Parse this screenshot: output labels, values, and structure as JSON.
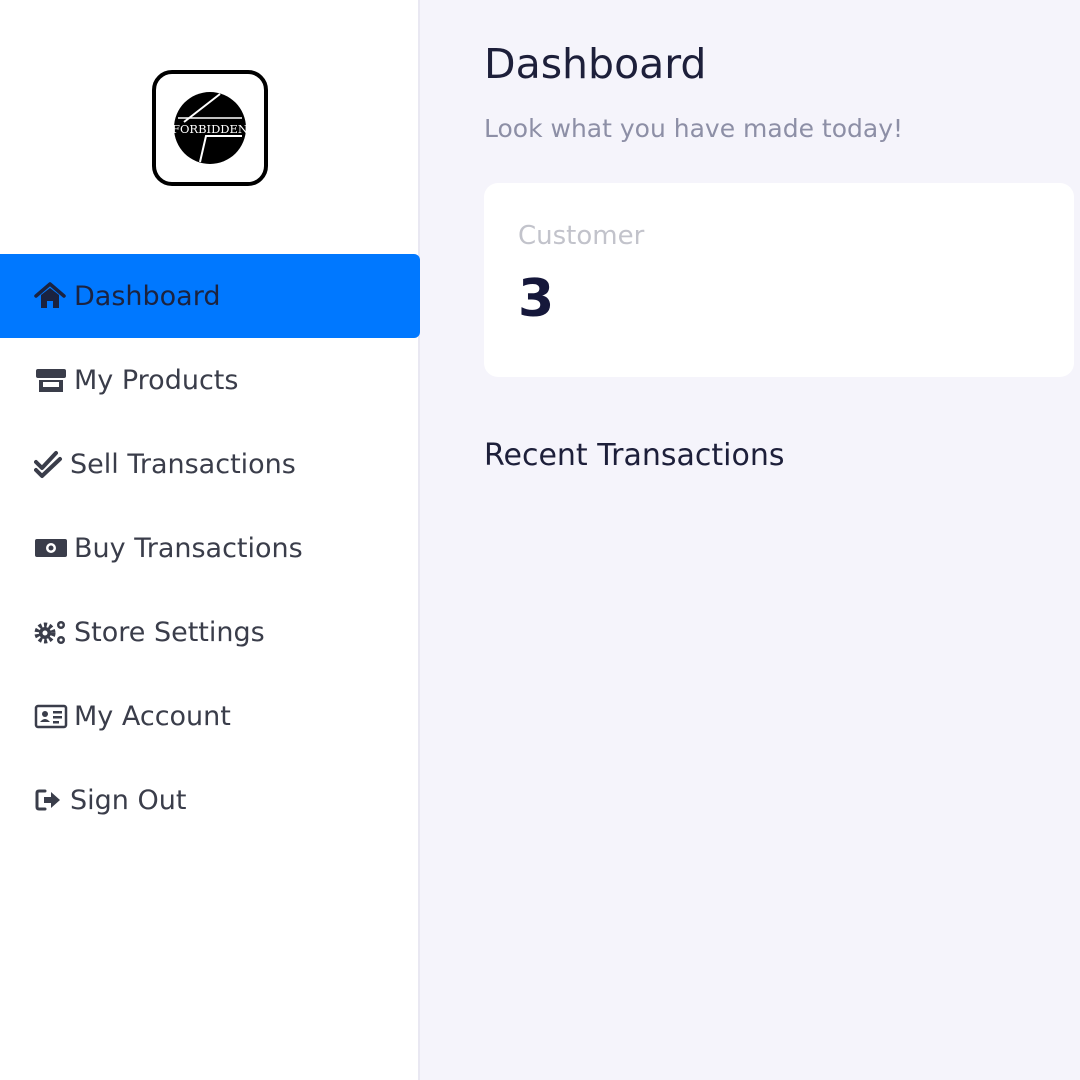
{
  "logo": {
    "text": "FORBIDDEN"
  },
  "sidebar": {
    "items": [
      {
        "label": "Dashboard",
        "icon": "home-icon",
        "active": true
      },
      {
        "label": "My Products",
        "icon": "store-icon"
      },
      {
        "label": "Sell Transactions",
        "icon": "double-check-icon"
      },
      {
        "label": "Buy Transactions",
        "icon": "money-bill-icon"
      },
      {
        "label": "Store Settings",
        "icon": "gears-icon"
      },
      {
        "label": "My Account",
        "icon": "id-card-icon"
      },
      {
        "label": "Sign Out",
        "icon": "sign-out-icon"
      }
    ]
  },
  "main": {
    "title": "Dashboard",
    "subtitle": "Look what you have made today!",
    "stat_card": {
      "label": "Customer",
      "value": "3"
    },
    "recent_title": "Recent Transactions"
  },
  "colors": {
    "accent": "#0078ff",
    "page_bg": "#f5f4fb",
    "sidebar_bg": "#ffffff"
  }
}
